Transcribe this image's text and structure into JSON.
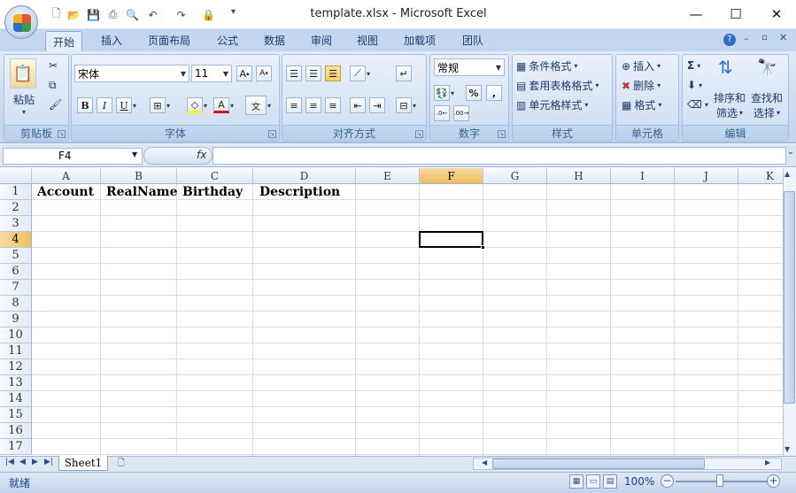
{
  "window": {
    "title": "template.xlsx - Microsoft Excel",
    "minimize": "—",
    "maximize": "☐",
    "close": "✕"
  },
  "tabs": [
    "开始",
    "插入",
    "页面布局",
    "公式",
    "数据",
    "审阅",
    "视图",
    "加载项",
    "团队"
  ],
  "ribbon": {
    "clipboard": {
      "label": "剪贴板",
      "paste": "粘贴"
    },
    "font": {
      "label": "字体",
      "name": "宋体",
      "size": "11"
    },
    "alignment": {
      "label": "对齐方式"
    },
    "number": {
      "label": "数字",
      "format": "常规"
    },
    "styles": {
      "label": "样式",
      "conditional": "条件格式",
      "table": "套用表格格式",
      "cell": "单元格样式"
    },
    "cells": {
      "label": "单元格",
      "insert": "插入",
      "delete": "删除",
      "format": "格式"
    },
    "editing": {
      "label": "编辑",
      "sort_l1": "排序和",
      "sort_l2": "筛选",
      "find_l1": "查找和",
      "find_l2": "选择"
    }
  },
  "formula_bar": {
    "name_box": "F4",
    "fx": "fx",
    "content": ""
  },
  "columns": [
    "A",
    "B",
    "C",
    "D",
    "E",
    "F",
    "G",
    "H",
    "I",
    "J",
    "K"
  ],
  "rows": [
    "1",
    "2",
    "3",
    "4",
    "5",
    "6",
    "7",
    "8",
    "9",
    "10",
    "11",
    "12",
    "13",
    "14",
    "15",
    "16",
    "17"
  ],
  "cells": {
    "A1": "Account",
    "B1": "RealName",
    "C1": "Birthday",
    "D1": "Description"
  },
  "active_cell": "F4",
  "sheets": {
    "sheet1": "Sheet1"
  },
  "status": {
    "ready": "就绪",
    "zoom": "100%"
  }
}
